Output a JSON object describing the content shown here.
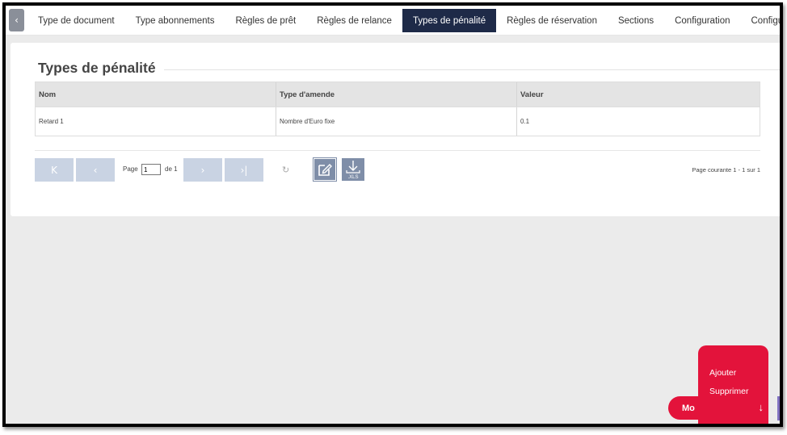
{
  "tabs": [
    {
      "label": "Type de document",
      "active": false
    },
    {
      "label": "Type abonnements",
      "active": false
    },
    {
      "label": "Règles de prêt",
      "active": false
    },
    {
      "label": "Règles de relance",
      "active": false
    },
    {
      "label": "Types de pénalité",
      "active": true
    },
    {
      "label": "Règles de réservation",
      "active": false
    },
    {
      "label": "Sections",
      "active": false
    },
    {
      "label": "Configuration",
      "active": false
    },
    {
      "label": "Configuration /",
      "active": false
    }
  ],
  "tab_scroll_left": "‹",
  "section": {
    "title": "Types de pénalité"
  },
  "grid": {
    "columns": [
      "Nom",
      "Type d'amende",
      "Valeur"
    ],
    "rows": [
      [
        "Retard 1",
        "Nombre d'Euro fixe",
        "0.1"
      ]
    ]
  },
  "pager": {
    "first": "K",
    "prev": "‹",
    "next": "›",
    "last": "›|",
    "page_label": "Page",
    "page_value": "1",
    "of_label": "de 1",
    "refresh": "↻",
    "xls_label": ".XLS",
    "status": "Page courante 1 - 1 sur 1"
  },
  "fab": {
    "items": [
      "Ajouter",
      "Supprimer"
    ],
    "button_label": "Mo",
    "arrow": "↓"
  },
  "colors": {
    "active_tab": "#1e2a48",
    "pager_button": "#c9d3e3",
    "icon_button": "#7f8ea8",
    "fab": "#e3133b"
  }
}
